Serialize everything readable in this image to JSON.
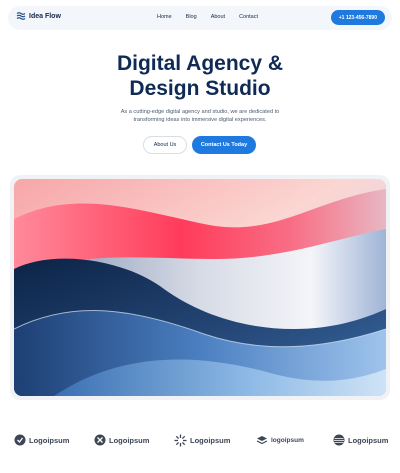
{
  "nav": {
    "brand": "Idea Flow",
    "links": [
      "Home",
      "Blog",
      "About",
      "Contact"
    ],
    "phone": "+1 123-456-7890"
  },
  "hero": {
    "title_line1": "Digital Agency &",
    "title_line2": "Design Studio",
    "desc_line1": "As a cutting-edge digital agency and studio, we are dedicated to",
    "desc_line2": "transforming ideas into immersive digital experiences.",
    "btn_about": "About Us",
    "btn_contact": "Contact Us Today"
  },
  "logos": [
    {
      "name": "Logoipsum"
    },
    {
      "name": "Logoipsum"
    },
    {
      "name": "Logoipsum"
    },
    {
      "name": "logoipsum"
    },
    {
      "name": "Logoipsum"
    }
  ],
  "colors": {
    "accent": "#1f7ae0",
    "title": "#0f2a55",
    "navbar_bg": "#f3f6fa"
  }
}
